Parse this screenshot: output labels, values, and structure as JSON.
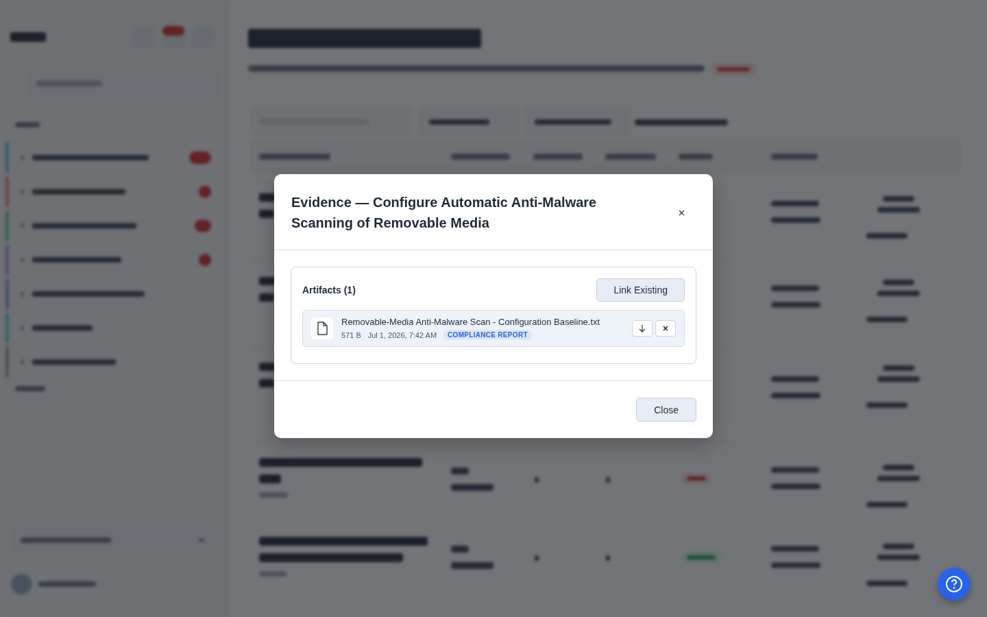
{
  "modal": {
    "title": "Evidence — Configure Automatic Anti-Malware Scanning of Removable Media",
    "section_title": "Artifacts (1)",
    "link_button": "Link Existing",
    "artifacts": [
      {
        "name": "Removable-Media Anti-Malware Scan - Configuration Baseline.txt",
        "size": "571 B",
        "date": "Jul 1, 2026, 7:42 AM",
        "tag": "COMPLIANCE REPORT"
      }
    ],
    "close_button": "Close"
  }
}
